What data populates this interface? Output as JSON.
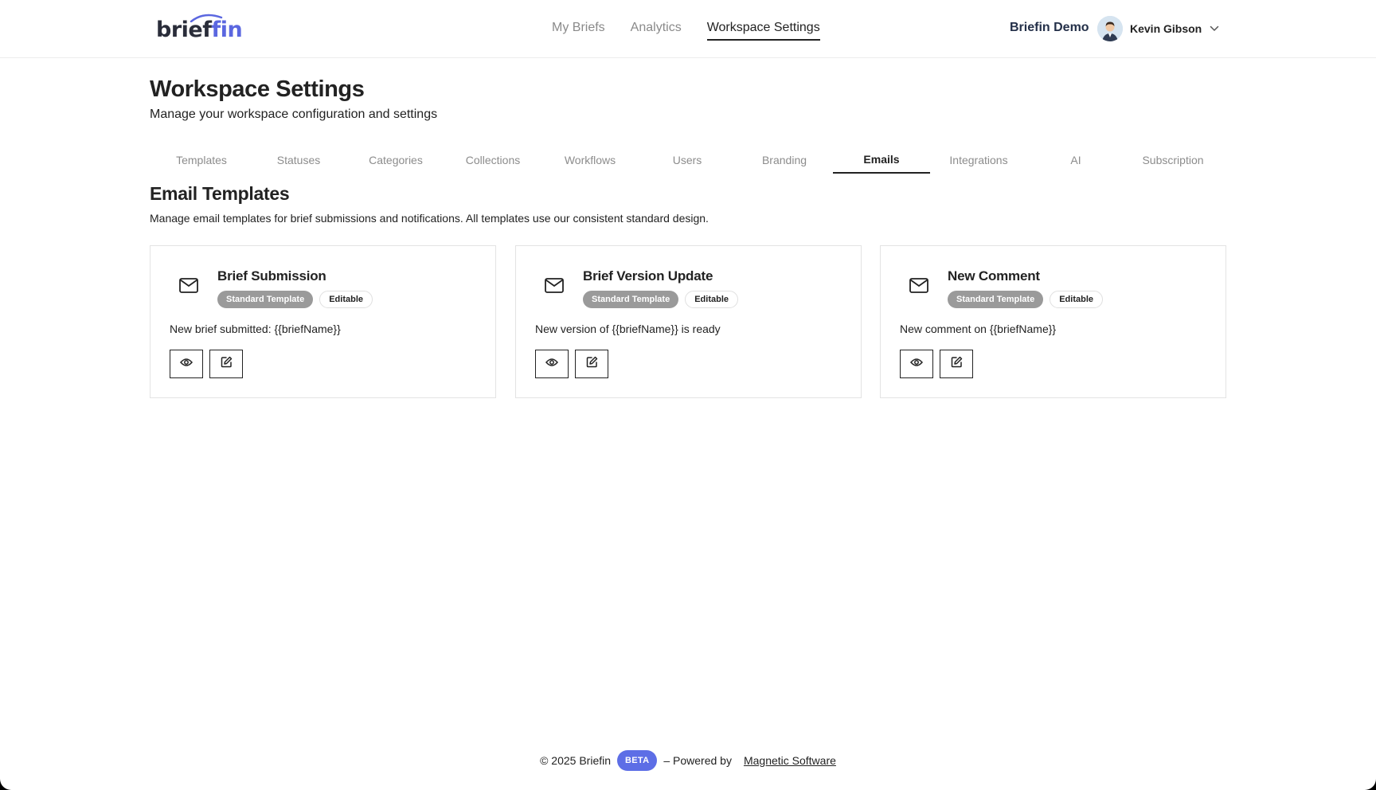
{
  "brand": {
    "logo_prefix": "brief",
    "logo_suffix": "in",
    "accent_color": "#5b67e0"
  },
  "header": {
    "nav": [
      {
        "label": "My Briefs",
        "active": false
      },
      {
        "label": "Analytics",
        "active": false
      },
      {
        "label": "Workspace Settings",
        "active": true
      }
    ],
    "workspace_name": "Briefin Demo",
    "user": {
      "name": "Kevin Gibson",
      "avatar_icon": "user-avatar",
      "menu_icon": "chevron-down-icon"
    }
  },
  "page": {
    "title": "Workspace Settings",
    "subtitle": "Manage your workspace configuration and settings"
  },
  "tabs": [
    {
      "label": "Templates"
    },
    {
      "label": "Statuses"
    },
    {
      "label": "Categories"
    },
    {
      "label": "Collections"
    },
    {
      "label": "Workflows"
    },
    {
      "label": "Users"
    },
    {
      "label": "Branding"
    },
    {
      "label": "Emails",
      "active": true
    },
    {
      "label": "Integrations"
    },
    {
      "label": "AI"
    },
    {
      "label": "Subscription"
    }
  ],
  "section": {
    "title": "Email Templates",
    "description": "Manage email templates for brief submissions and notifications. All templates use our consistent standard design."
  },
  "cards": [
    {
      "title": "Brief Submission",
      "badge_standard": "Standard Template",
      "badge_editable": "Editable",
      "subject": "New brief submitted: {{briefName}}",
      "icon": "mail-icon",
      "actions": [
        "eye-icon",
        "edit-icon"
      ]
    },
    {
      "title": "Brief Version Update",
      "badge_standard": "Standard Template",
      "badge_editable": "Editable",
      "subject": "New version of {{briefName}} is ready",
      "icon": "mail-icon",
      "actions": [
        "eye-icon",
        "edit-icon"
      ]
    },
    {
      "title": "New Comment",
      "badge_standard": "Standard Template",
      "badge_editable": "Editable",
      "subject": "New comment on {{briefName}}",
      "icon": "mail-icon",
      "actions": [
        "eye-icon",
        "edit-icon"
      ]
    }
  ],
  "footer": {
    "copyright": "© 2025 Briefin",
    "beta_label": "BETA",
    "powered_by": "– Powered by",
    "company_link": "Magnetic Software",
    "beta_color": "#5d6ee6"
  }
}
